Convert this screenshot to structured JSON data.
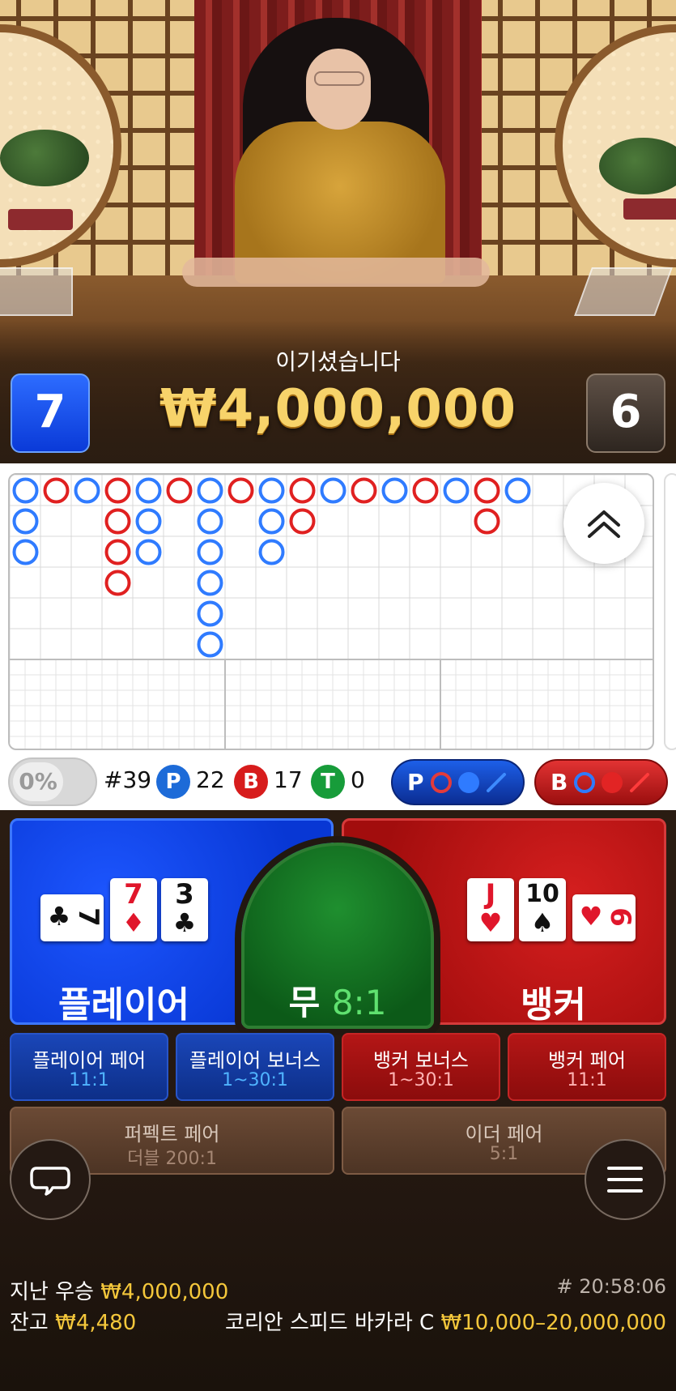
{
  "result": {
    "message": "이기셨습니다",
    "amount": "₩4,000,000",
    "player_score": "7",
    "banker_score": "6"
  },
  "roadmap": {
    "big_road": [
      [
        "P",
        "P",
        "P"
      ],
      [
        "B"
      ],
      [
        "P"
      ],
      [
        "B",
        "B",
        "B",
        "B"
      ],
      [
        "P",
        "P",
        "P"
      ],
      [
        "B"
      ],
      [
        "P",
        "P",
        "P",
        "P",
        "P",
        "P"
      ],
      [
        "B"
      ],
      [
        "P",
        "P",
        "P"
      ],
      [
        "B",
        "B"
      ],
      [
        "P"
      ],
      [
        "B"
      ],
      [
        "P"
      ],
      [
        "B"
      ],
      [
        "P"
      ],
      [
        "B",
        "B"
      ],
      [
        "P"
      ]
    ]
  },
  "stats": {
    "percent_toggle": "0%",
    "shoe_round": "#39",
    "player_letter": "P",
    "player_count": "22",
    "banker_letter": "B",
    "banker_count": "17",
    "tie_letter": "T",
    "tie_count": "0",
    "predict_player": "P",
    "predict_banker": "B"
  },
  "colors": {
    "player": "#0b3ee0",
    "banker": "#c21414",
    "tie": "#1c8c2e",
    "gold": "#f4c73b"
  },
  "main_bets": {
    "player_label": "플레이어",
    "banker_label": "뱅커",
    "tie_label": "무",
    "tie_odds": "8:1"
  },
  "player_cards": [
    {
      "rank": "7",
      "suit": "♣",
      "color": "black",
      "orientation": "side"
    },
    {
      "rank": "7",
      "suit": "♦",
      "color": "red",
      "orientation": "upright"
    },
    {
      "rank": "3",
      "suit": "♣",
      "color": "black",
      "orientation": "upright"
    }
  ],
  "banker_cards": [
    {
      "rank": "J",
      "suit": "♥",
      "color": "red",
      "orientation": "upright"
    },
    {
      "rank": "10",
      "suit": "♠",
      "color": "black",
      "orientation": "upright"
    },
    {
      "rank": "6",
      "suit": "♥",
      "color": "red",
      "orientation": "side"
    }
  ],
  "side_bets": [
    {
      "name": "플레이어 페어",
      "odds": "11:1"
    },
    {
      "name": "플레이어 보너스",
      "odds": "1~30:1"
    },
    {
      "name": "뱅커 보너스",
      "odds": "1~30:1"
    },
    {
      "name": "뱅커 페어",
      "odds": "11:1"
    },
    {
      "name": "퍼펙트 페어",
      "odds": "더블 200:1"
    },
    {
      "name": "이더 페어",
      "odds": "5:1"
    }
  ],
  "footer": {
    "last_win_label": "지난 우승",
    "last_win_amount": "₩4,000,000",
    "timestamp": "# 20:58:06",
    "balance_label": "잔고",
    "balance_amount": "₩4,480",
    "table_name": "코리안 스피드 바카라 C",
    "bet_limits": "₩10,000–20,000,000"
  },
  "icons": [
    "chevron-double-up-icon",
    "chat-bubble-icon",
    "hamburger-menu-icon"
  ]
}
